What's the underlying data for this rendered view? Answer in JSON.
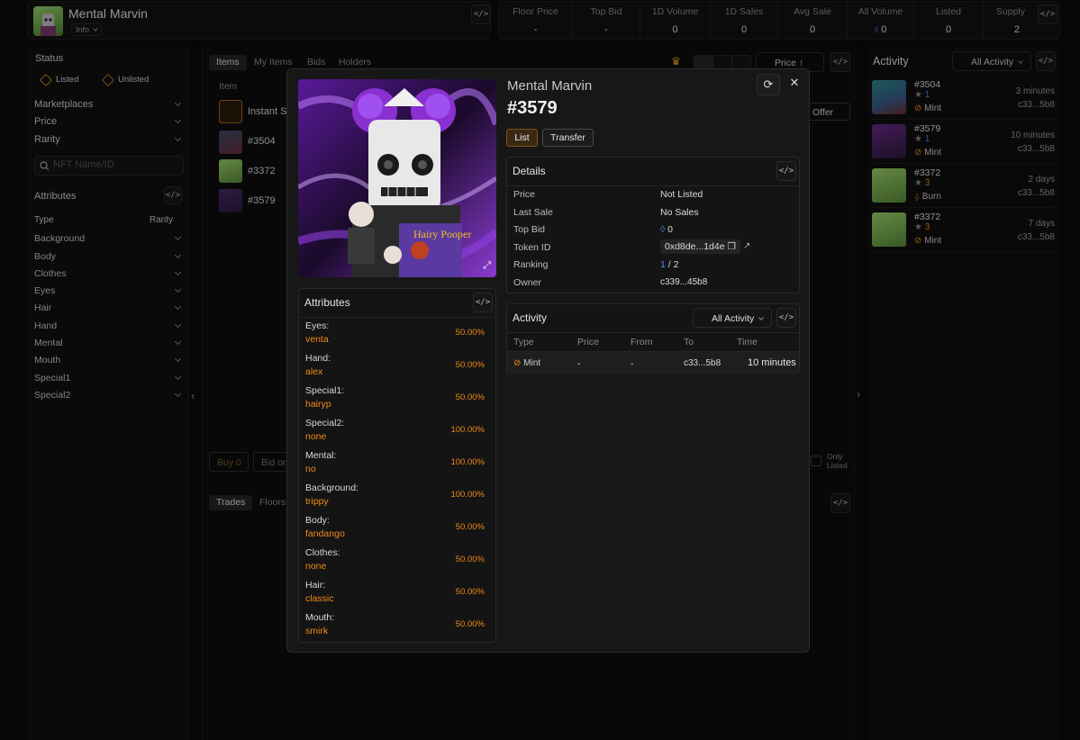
{
  "header": {
    "collection_title": "Mental Marvin",
    "info_label": "Info",
    "stats": [
      {
        "label": "Floor Price",
        "value": "-"
      },
      {
        "label": "Top Bid",
        "value": "-"
      },
      {
        "label": "1D Volume",
        "value": "0"
      },
      {
        "label": "1D Sales",
        "value": "0"
      },
      {
        "label": "Avg Sale",
        "value": "0"
      },
      {
        "label": "All Volume",
        "value": "0"
      },
      {
        "label": "Listed",
        "value": "0"
      },
      {
        "label": "Supply",
        "value": "2"
      }
    ]
  },
  "sidebar": {
    "status_label": "Status",
    "listed_label": "Listed",
    "unlisted_label": "Unlisted",
    "filters": [
      "Marketplaces",
      "Price",
      "Rarity"
    ],
    "search_placeholder": "NFT Name/ID",
    "attributes_label": "Attributes",
    "type_header": "Type",
    "rarity_header": "Rarity",
    "attribute_types": [
      "Background",
      "Body",
      "Clothes",
      "Eyes",
      "Hair",
      "Hand",
      "Mental",
      "Mouth",
      "Special1",
      "Special2"
    ]
  },
  "center": {
    "tabs": [
      "Items",
      "My Items",
      "Bids",
      "Holders"
    ],
    "sort_label": "Price",
    "item_header": "Item",
    "items": [
      "Instant Se",
      "#3504",
      "#3372",
      "#3579"
    ],
    "make_offer_label": "ke Offer",
    "buy_label": "Buy 0",
    "bid_label": "Bid on",
    "only_listed_label": "Only Listed",
    "bottom_tabs": [
      "Trades",
      "Floors"
    ]
  },
  "activity_panel": {
    "title": "Activity",
    "filter_label": "All Activity",
    "items": [
      {
        "id": "#3504",
        "rank": "1",
        "type": "Mint",
        "time": "3 minutes",
        "addr": "c33...5b8"
      },
      {
        "id": "#3579",
        "rank": "1",
        "type": "Mint",
        "time": "10 minutes",
        "addr": "c33...5b8"
      },
      {
        "id": "#3372",
        "rank": "3",
        "type": "Burn",
        "time": "2 days",
        "addr": "c33...5b8"
      },
      {
        "id": "#3372",
        "rank": "3",
        "type": "Mint",
        "time": "7 days",
        "addr": "c33...5b8"
      }
    ]
  },
  "modal": {
    "collection": "Mental Marvin",
    "token": "#3579",
    "list_label": "List",
    "transfer_label": "Transfer",
    "details_title": "Details",
    "details": [
      {
        "label": "Price",
        "value": "Not Listed"
      },
      {
        "label": "Last Sale",
        "value": "No Sales"
      },
      {
        "label": "Top Bid",
        "value": "0"
      },
      {
        "label": "Token ID",
        "value": "0xd8de...1d4e"
      },
      {
        "label": "Ranking",
        "value": "1",
        "value2": " / 2"
      },
      {
        "label": "Owner",
        "value": "c339...45b8"
      }
    ],
    "attributes_title": "Attributes",
    "attributes": [
      {
        "name": "Eyes:",
        "value": "venta",
        "pct": "50.00%"
      },
      {
        "name": "Hand:",
        "value": "alex",
        "pct": "50.00%"
      },
      {
        "name": "Special1:",
        "value": "hairyp",
        "pct": "50.00%"
      },
      {
        "name": "Special2:",
        "value": "none",
        "pct": "100.00%"
      },
      {
        "name": "Mental:",
        "value": "no",
        "pct": "100.00%"
      },
      {
        "name": "Background:",
        "value": "trippy",
        "pct": "100.00%"
      },
      {
        "name": "Body:",
        "value": "fandango",
        "pct": "50.00%"
      },
      {
        "name": "Clothes:",
        "value": "none",
        "pct": "50.00%"
      },
      {
        "name": "Hair:",
        "value": "classic",
        "pct": "50.00%"
      },
      {
        "name": "Mouth:",
        "value": "smirk",
        "pct": "50.00%"
      }
    ],
    "activity_title": "Activity",
    "activity_filter": "All Activity",
    "activity_headers": [
      "Type",
      "Price",
      "From",
      "To",
      "Time"
    ],
    "activity_row": {
      "type": "Mint",
      "price": "-",
      "from": "-",
      "to": "c33...5b8",
      "time": "10 minutes"
    },
    "image_text": "Hairy Pooper"
  },
  "colors": {
    "accent": "#f08a1a",
    "rank_blue": "#4a8cf0",
    "background": "#0a0a0a"
  }
}
